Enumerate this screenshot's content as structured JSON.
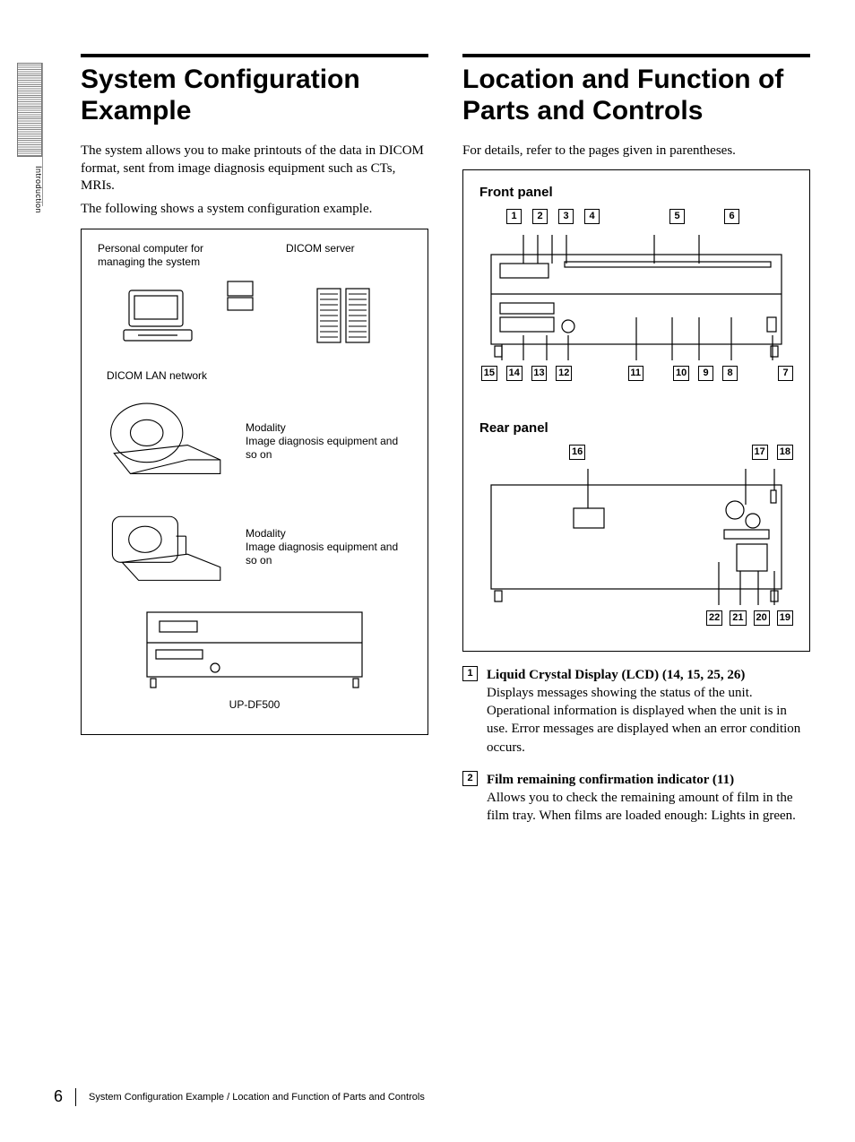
{
  "sideTab": {
    "label": "Introduction"
  },
  "left": {
    "heading": "System Configuration Example",
    "para1": "The system allows you to make printouts of the data in DICOM format, sent from image diagnosis equipment such as CTs, MRIs.",
    "para2": "The following shows a system configuration example.",
    "fig": {
      "pcLabel": "Personal computer for managing the system",
      "serverLabel": "DICOM server",
      "lanLabel": "DICOM LAN network",
      "modality1a": "Modality",
      "modality1b": "Image diagnosis equipment and so on",
      "modality2a": "Modality",
      "modality2b": "Image diagnosis equipment and so on",
      "product": "UP-DF500"
    }
  },
  "right": {
    "heading": "Location and Function of Parts and Controls",
    "para1": "For details, refer to the pages given in parentheses.",
    "frontTitle": "Front panel",
    "frontTop": [
      "1",
      "2",
      "3",
      "4",
      "5",
      "6"
    ],
    "frontBottom": [
      "15",
      "14",
      "13",
      "12",
      "11",
      "10",
      "9",
      "8",
      "7"
    ],
    "rearTitle": "Rear panel",
    "rearTop": [
      "16",
      "17",
      "18"
    ],
    "rearBottom": [
      "22",
      "21",
      "20",
      "19"
    ],
    "items": [
      {
        "num": "1",
        "title": "Liquid Crystal Display (LCD) (14, 15, 25, 26)",
        "body": "Displays messages showing the status of the unit. Operational information is displayed when the unit is in use. Error messages are displayed when an error condition occurs."
      },
      {
        "num": "2",
        "title": "Film remaining confirmation indicator (11)",
        "body": "Allows you to check the remaining amount of film in the film tray.\nWhen films are loaded enough: Lights in green."
      }
    ]
  },
  "footer": {
    "page": "6",
    "text": "System Configuration Example / Location and Function of Parts and Controls"
  }
}
